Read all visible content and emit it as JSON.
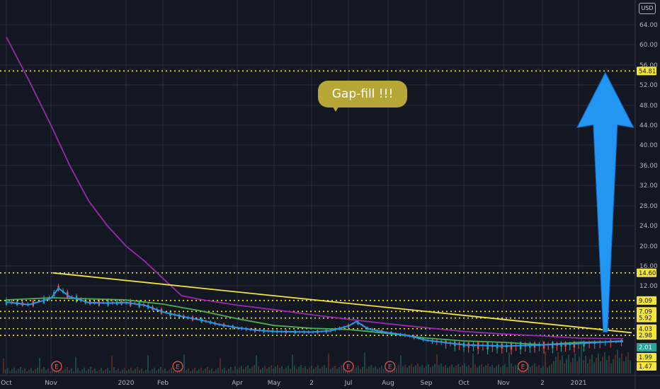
{
  "currency_badge": "USD",
  "annotation_text": "Gap-fill !!!",
  "colors": {
    "background": "#131722",
    "grid": "#2a2e39",
    "level_line": "#f5e43a",
    "trendline": "#f5e43a",
    "purple_ma": "#9c27b0",
    "green_ma": "#4caf50",
    "blue_ma": "#2196f3",
    "arrow": "#2196f3",
    "up_candle": "#26a69a",
    "down_candle": "#ef5350",
    "bubble": "#b5a635"
  },
  "chart_data": {
    "type": "line",
    "title": "",
    "xlabel": "",
    "ylabel": "",
    "ylim": [
      0,
      68
    ],
    "y_ticks": [
      "64.00",
      "60.00",
      "56.00",
      "52.00",
      "48.00",
      "44.00",
      "40.00",
      "36.00",
      "32.00",
      "28.00",
      "24.00",
      "20.00",
      "16.00",
      "12.00"
    ],
    "x_ticks": [
      {
        "label": "Oct",
        "x": 0
      },
      {
        "label": "Nov",
        "x": 1
      },
      {
        "label": "2020",
        "x": 3
      },
      {
        "label": "Feb",
        "x": 4
      },
      {
        "label": "Apr",
        "x": 6
      },
      {
        "label": "May",
        "x": 7
      },
      {
        "label": "2",
        "x": 8
      },
      {
        "label": "Jul",
        "x": 9
      },
      {
        "label": "Aug",
        "x": 10
      },
      {
        "label": "Sep",
        "x": 11
      },
      {
        "label": "Oct",
        "x": 12
      },
      {
        "label": "Nov",
        "x": 13
      },
      {
        "label": "2",
        "x": 14
      },
      {
        "label": "2021",
        "x": 15
      }
    ],
    "horizontal_levels": [
      {
        "label": "54.81",
        "value": 54.81
      },
      {
        "label": "14.60",
        "value": 14.6
      },
      {
        "label": "9.09",
        "value": 9.09
      },
      {
        "label": "7.09",
        "value": 7.09
      },
      {
        "label": "5.92",
        "value": 5.92
      },
      {
        "label": "4.03",
        "value": 4.03
      },
      {
        "label": "2.98",
        "value": 2.98
      }
    ],
    "price_labels": [
      {
        "label": "2.01",
        "value": 2.01,
        "color": "#26a69a"
      },
      {
        "label": "1.99",
        "value": 1.99,
        "color": "#f5e43a"
      },
      {
        "label": "1.47",
        "value": 1.47,
        "color": "#f5e43a"
      }
    ],
    "earnings_markers": [
      {
        "label": "E",
        "x": 1.15
      },
      {
        "label": "E",
        "x": 4.4
      },
      {
        "label": "E",
        "x": 9.0
      },
      {
        "label": "E",
        "x": 10.05
      },
      {
        "label": "E",
        "x": 13.5
      }
    ],
    "trendline": {
      "x": [
        1.05,
        16.2
      ],
      "y": [
        14.6,
        3.4
      ]
    },
    "arrow": {
      "x": 15.6,
      "y_from": 3.5,
      "y_to": 54.5
    },
    "series": [
      {
        "name": "",
        "color": "#9c27b0",
        "x": [
          0,
          0.5,
          1,
          1.5,
          2,
          2.5,
          3,
          3.5,
          4,
          4.5,
          5,
          6,
          7,
          8,
          9,
          10,
          11,
          12,
          13,
          14,
          15,
          16
        ],
        "y": [
          61.5,
          53,
          44,
          36,
          29,
          24,
          20,
          17,
          13.5,
          10,
          9.3,
          8.2,
          7.4,
          6.5,
          5.7,
          4.9,
          4.2,
          3.6,
          3.2,
          2.9,
          2.6,
          2.5
        ]
      },
      {
        "name": "",
        "color": "#4caf50",
        "x": [
          0,
          1,
          2,
          3,
          4,
          5,
          6,
          7,
          8,
          9,
          10,
          11,
          12,
          13,
          14,
          15,
          16
        ],
        "y": [
          9.2,
          9.6,
          9.4,
          9.2,
          8.4,
          7.2,
          5.8,
          4.6,
          4.1,
          3.9,
          3.3,
          2.6,
          2.2,
          2.0,
          1.9,
          2.0,
          2.1
        ]
      },
      {
        "name": "",
        "color": "#2196f3",
        "x": [
          0,
          0.5,
          1,
          1.2,
          1.5,
          2,
          2.5,
          3,
          3.5,
          4,
          4.5,
          5,
          5.5,
          6,
          6.5,
          7,
          8,
          8.5,
          9,
          9.2,
          9.5,
          10,
          10.5,
          11,
          12,
          13,
          14,
          15,
          16
        ],
        "y": [
          8.8,
          8.3,
          9.5,
          11.5,
          9.8,
          8.7,
          8.6,
          8.7,
          8.2,
          7.0,
          6.2,
          5.6,
          4.8,
          4.2,
          3.8,
          3.6,
          3.5,
          3.7,
          4.5,
          5.3,
          4.0,
          3.4,
          3.0,
          2.3,
          1.9,
          1.85,
          1.9,
          1.95,
          2.2
        ]
      }
    ]
  }
}
